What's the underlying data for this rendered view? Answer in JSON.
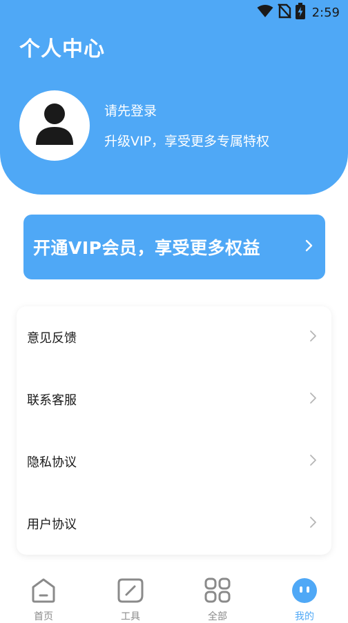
{
  "status_bar": {
    "time": "2:59"
  },
  "header": {
    "title": "个人中心",
    "login_prompt": "请先登录",
    "vip_subtitle": "升级VIP，享受更多专属特权"
  },
  "vip_banner": {
    "text": "开通VIP会员，享受更多权益"
  },
  "menu": {
    "items": [
      {
        "label": "意见反馈"
      },
      {
        "label": "联系客服"
      },
      {
        "label": "隐私协议"
      },
      {
        "label": "用户协议"
      }
    ]
  },
  "tab_bar": {
    "tabs": [
      {
        "label": "首页",
        "icon": "home-icon"
      },
      {
        "label": "工具",
        "icon": "tools-icon"
      },
      {
        "label": "全部",
        "icon": "grid-icon"
      },
      {
        "label": "我的",
        "icon": "profile-icon"
      }
    ],
    "active_index": 3
  },
  "colors": {
    "accent": "#4fa8f6",
    "inactive": "#8a8a8a"
  }
}
